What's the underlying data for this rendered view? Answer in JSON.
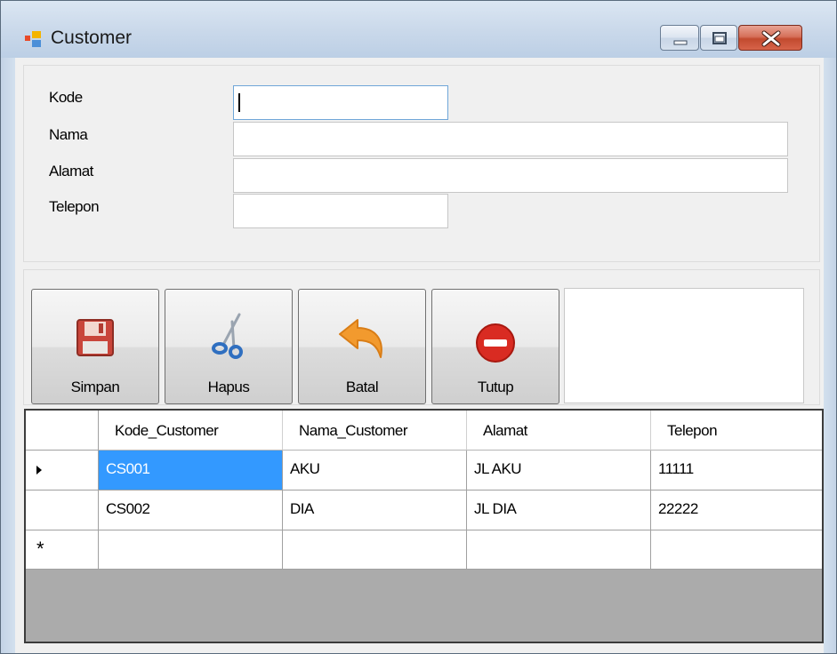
{
  "window": {
    "title": "Customer"
  },
  "form": {
    "fields": [
      {
        "label": "Kode",
        "value": ""
      },
      {
        "label": "Nama",
        "value": ""
      },
      {
        "label": "Alamat",
        "value": ""
      },
      {
        "label": "Telepon",
        "value": ""
      }
    ]
  },
  "toolbar": {
    "buttons": [
      {
        "label": "Simpan",
        "icon": "floppy-disk-icon"
      },
      {
        "label": "Hapus",
        "icon": "scissors-icon"
      },
      {
        "label": "Batal",
        "icon": "undo-arrow-icon"
      },
      {
        "label": "Tutup",
        "icon": "stop-icon"
      }
    ]
  },
  "grid": {
    "columns": [
      "Kode_Customer",
      "Nama_Customer",
      "Alamat",
      "Telepon"
    ],
    "rows": [
      [
        "CS001",
        "AKU",
        "JL AKU",
        "11111"
      ],
      [
        "CS002",
        "DIA",
        "JL DIA",
        "22222"
      ]
    ],
    "new_row_marker": "*",
    "selected_cell": "CS001"
  },
  "colors": {
    "selection": "#3399ff",
    "close_button": "#c94a30",
    "titlebar": "#c9d8ea"
  }
}
